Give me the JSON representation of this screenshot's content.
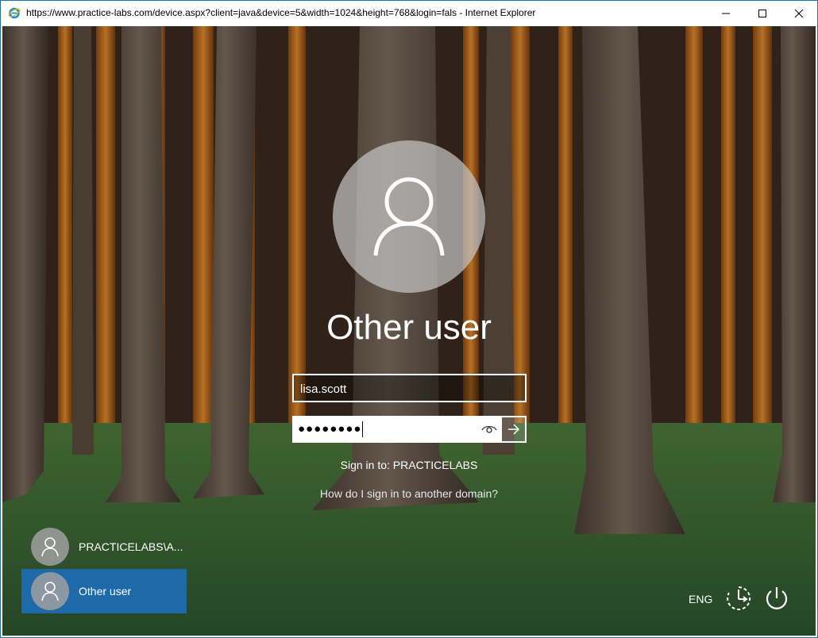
{
  "window": {
    "title": "https://www.practice-labs.com/device.aspx?client=java&device=5&width=1024&height=768&login=fals - Internet Explorer",
    "app_icon": "internet-explorer-icon",
    "controls": [
      "minimize-icon",
      "maximize-icon",
      "close-icon"
    ]
  },
  "login": {
    "user_display_name": "Other user",
    "username_value": "lisa.scott",
    "password_mask": "●●●●●●●●",
    "sign_in_to": "Sign in to: PRACTICELABS",
    "domain_help_link": "How do I sign in to another domain?"
  },
  "user_list": [
    {
      "label": "PRACTICELABS\\A...",
      "selected": false
    },
    {
      "label": "Other user",
      "selected": true
    }
  ],
  "system_tray": {
    "language": "ENG",
    "ease_of_access_icon": "ease-of-access-icon",
    "power_icon": "power-icon"
  },
  "colors": {
    "selected_tile": "#1e6aa8",
    "window_border": "#1c6fb5"
  }
}
